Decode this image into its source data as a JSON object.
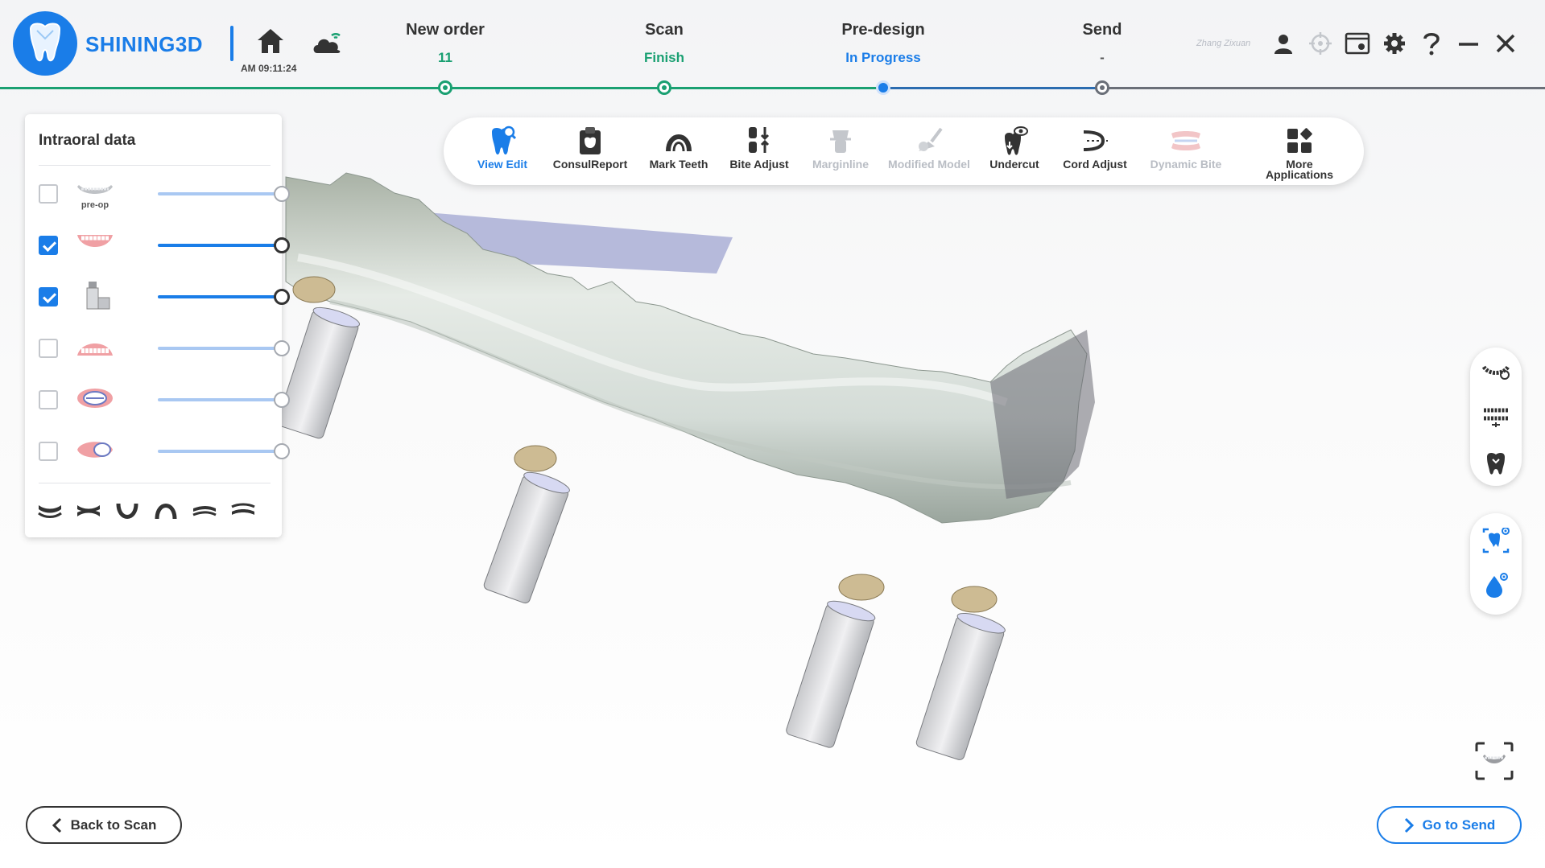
{
  "app": {
    "brand": "SHINING3D",
    "clock": "AM 09:11:24",
    "user": "Zhang Zixuan"
  },
  "steps": [
    {
      "title": "New order",
      "status": "11",
      "color": "#1aa072"
    },
    {
      "title": "Scan",
      "status": "Finish",
      "color": "#1aa072"
    },
    {
      "title": "Pre-design",
      "status": "In Progress",
      "color": "#1a7de8"
    },
    {
      "title": "Send",
      "status": "-",
      "color": "#555555"
    }
  ],
  "panel": {
    "title": "Intraoral data",
    "rows": [
      {
        "checked": false,
        "label": "pre-op",
        "level": 1.0
      },
      {
        "checked": true,
        "label": "",
        "level": 1.0
      },
      {
        "checked": true,
        "label": "",
        "level": 1.0
      },
      {
        "checked": false,
        "label": "",
        "level": 1.0
      },
      {
        "checked": false,
        "label": "",
        "level": 1.0
      },
      {
        "checked": false,
        "label": "",
        "level": 1.0
      }
    ]
  },
  "toolbar": {
    "tools": [
      {
        "label": "View Edit",
        "state": "selected",
        "icon": "tooth-view-icon"
      },
      {
        "label": "ConsulReport",
        "state": "normal",
        "icon": "clipboard-icon"
      },
      {
        "label": "Mark Teeth",
        "state": "normal",
        "icon": "mark-teeth-icon"
      },
      {
        "label": "Bite Adjust",
        "state": "normal",
        "icon": "bite-adjust-icon"
      },
      {
        "label": "Marginline",
        "state": "disabled",
        "icon": "marginline-icon"
      },
      {
        "label": "Modified Model",
        "state": "disabled",
        "icon": "modified-model-icon"
      },
      {
        "label": "Undercut",
        "state": "normal",
        "icon": "undercut-icon"
      },
      {
        "label": "Cord Adjust",
        "state": "normal",
        "icon": "cord-adjust-icon"
      },
      {
        "label": "Dynamic Bite",
        "state": "disabled",
        "icon": "dynamic-bite-icon"
      },
      {
        "label": "More",
        "label2": "Applications",
        "state": "normal",
        "icon": "more-apps-icon"
      }
    ]
  },
  "buttons": {
    "back": "Back to Scan",
    "next": "Go to Send"
  },
  "colors": {
    "accent": "#1a7de8",
    "success": "#1aa072"
  }
}
